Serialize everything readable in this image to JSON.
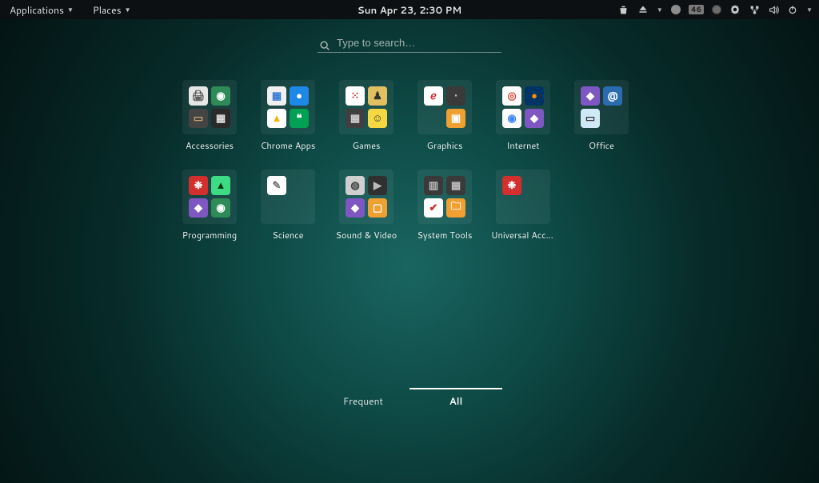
{
  "topbar": {
    "menus": [
      {
        "label": "Applications"
      },
      {
        "label": "Places"
      }
    ],
    "clock": "Sun Apr 23,  2:30 PM",
    "indicators": {
      "badge": "46"
    }
  },
  "search": {
    "placeholder": "Type to search…"
  },
  "folders": [
    {
      "label": "Accessories",
      "icons": [
        {
          "bg": "#e6e6e6",
          "fg": "#555",
          "glyph": "🖨"
        },
        {
          "bg": "#2e8b57",
          "fg": "#fff",
          "glyph": "◉"
        },
        {
          "bg": "#444",
          "fg": "#c7a96b",
          "glyph": "▭"
        },
        {
          "bg": "#2a2a2a",
          "fg": "#ddd",
          "glyph": "▦"
        }
      ]
    },
    {
      "label": "Chrome Apps",
      "icons": [
        {
          "bg": "#f0f0f0",
          "fg": "#3a7bd5",
          "glyph": "▦"
        },
        {
          "bg": "#1e88e5",
          "fg": "#fff",
          "glyph": "●"
        },
        {
          "bg": "#ffffff",
          "fg": "#f4b400",
          "glyph": "▲"
        },
        {
          "bg": "#00a152",
          "fg": "#fff",
          "glyph": "❝"
        }
      ]
    },
    {
      "label": "Games",
      "icons": [
        {
          "bg": "#fff",
          "fg": "#d32f2f",
          "glyph": "⁙"
        },
        {
          "bg": "#e0c060",
          "fg": "#333",
          "glyph": "♟"
        },
        {
          "bg": "#3f3f3f",
          "fg": "#ccc",
          "glyph": "▦"
        },
        {
          "bg": "#f5d742",
          "fg": "#333",
          "glyph": "☺"
        }
      ]
    },
    {
      "label": "Graphics",
      "icons": [
        {
          "bg": "#fff",
          "fg": "#d32f2f",
          "glyph": "ℯ"
        },
        {
          "bg": "#3a3a3a",
          "fg": "#bbb",
          "glyph": "•"
        },
        {
          "bg": "transparent",
          "fg": "",
          "glyph": ""
        },
        {
          "bg": "#f0a030",
          "fg": "#fff",
          "glyph": "▣"
        }
      ]
    },
    {
      "label": "Internet",
      "icons": [
        {
          "bg": "#fff",
          "fg": "#db4437",
          "glyph": "◎"
        },
        {
          "bg": "#003366",
          "fg": "#ff8a00",
          "glyph": "●"
        },
        {
          "bg": "#fff",
          "fg": "#4285f4",
          "glyph": "◉"
        },
        {
          "bg": "#7e57c2",
          "fg": "#fff",
          "glyph": "◆"
        }
      ]
    },
    {
      "label": "Office",
      "icons": [
        {
          "bg": "#7e57c2",
          "fg": "#fff",
          "glyph": "◆"
        },
        {
          "bg": "#2b6cb0",
          "fg": "#fff",
          "glyph": "@"
        },
        {
          "bg": "#cfe9f7",
          "fg": "#333",
          "glyph": "▭"
        },
        {
          "bg": "transparent",
          "fg": "",
          "glyph": ""
        }
      ]
    },
    {
      "label": "Programming",
      "icons": [
        {
          "bg": "#d32f2f",
          "fg": "#fff",
          "glyph": "❉"
        },
        {
          "bg": "#3ddc84",
          "fg": "#0b3d0b",
          "glyph": "▲"
        },
        {
          "bg": "#7e57c2",
          "fg": "#fff",
          "glyph": "◆"
        },
        {
          "bg": "#2e8b57",
          "fg": "#fff",
          "glyph": "◉"
        }
      ]
    },
    {
      "label": "Science",
      "icons": [
        {
          "bg": "#ffffff",
          "fg": "#777",
          "glyph": "✎"
        },
        {
          "bg": "transparent",
          "fg": "",
          "glyph": ""
        },
        {
          "bg": "transparent",
          "fg": "",
          "glyph": ""
        },
        {
          "bg": "transparent",
          "fg": "",
          "glyph": ""
        }
      ]
    },
    {
      "label": "Sound & Video",
      "icons": [
        {
          "bg": "#cfcfcf",
          "fg": "#444",
          "glyph": "◍"
        },
        {
          "bg": "#303030",
          "fg": "#bbb",
          "glyph": "▶"
        },
        {
          "bg": "#7e57c2",
          "fg": "#fff",
          "glyph": "◆"
        },
        {
          "bg": "#f0a030",
          "fg": "#fff",
          "glyph": "▢"
        }
      ]
    },
    {
      "label": "System Tools",
      "icons": [
        {
          "bg": "#3a3a3a",
          "fg": "#bbb",
          "glyph": "▥"
        },
        {
          "bg": "#3a3a3a",
          "fg": "#bbb",
          "glyph": "▦"
        },
        {
          "bg": "#fff",
          "fg": "#d32f2f",
          "glyph": "✔"
        },
        {
          "bg": "#f0a030",
          "fg": "#fff",
          "glyph": "🗀"
        }
      ]
    },
    {
      "label": "Universal Access",
      "icons": [
        {
          "bg": "#d32f2f",
          "fg": "#fff",
          "glyph": "❉"
        },
        {
          "bg": "transparent",
          "fg": "",
          "glyph": ""
        },
        {
          "bg": "transparent",
          "fg": "",
          "glyph": ""
        },
        {
          "bg": "transparent",
          "fg": "",
          "glyph": ""
        }
      ]
    }
  ],
  "tabs": {
    "frequent": "Frequent",
    "all": "All",
    "active": "all"
  }
}
